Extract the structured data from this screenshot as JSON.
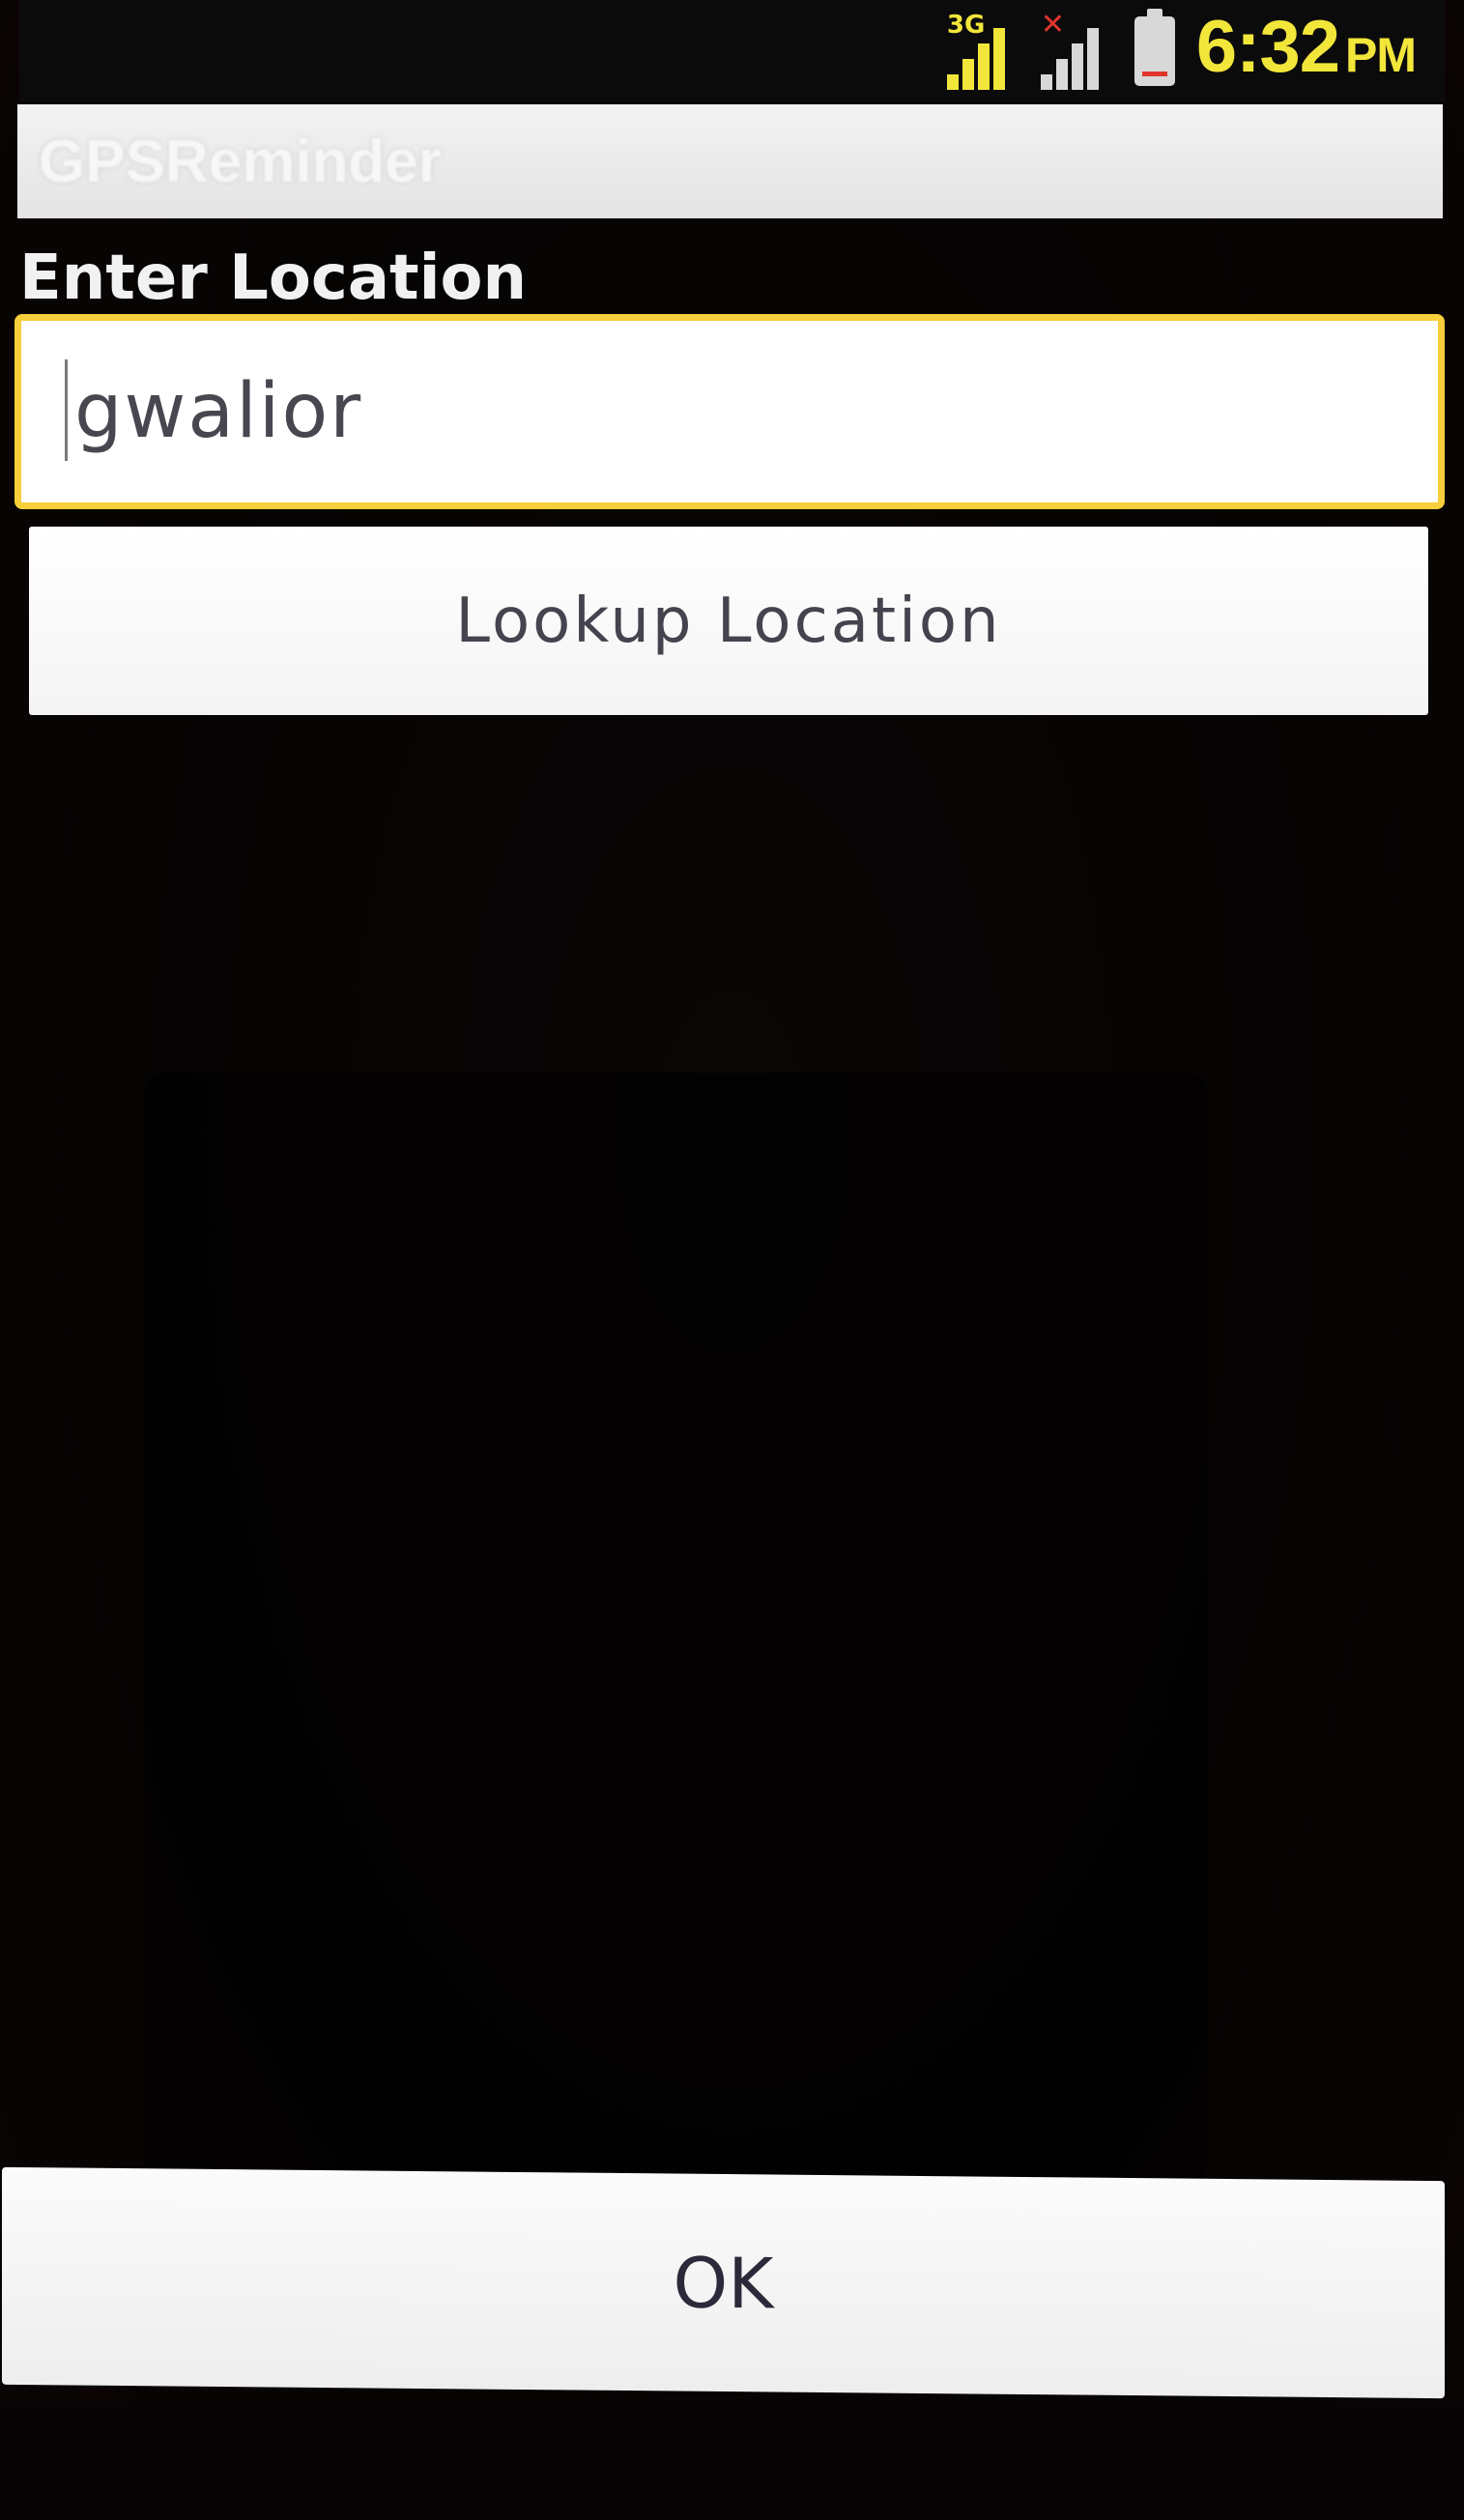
{
  "status_bar": {
    "network_type": "3G",
    "time": "6:32",
    "ampm": "PM",
    "signal1_color": "#f2e63a",
    "signal2_color": "#d8d8d8",
    "battery_icon": "battery-low-icon"
  },
  "app": {
    "title": "GPSReminder"
  },
  "form": {
    "label": "Enter Location",
    "input_value": "gwalior",
    "input_placeholder": "",
    "lookup_button_label": "Lookup Location",
    "ok_button_label": "OK"
  },
  "colors": {
    "input_focus_border": "#f6cf3a",
    "clock": "#f2e63a"
  }
}
